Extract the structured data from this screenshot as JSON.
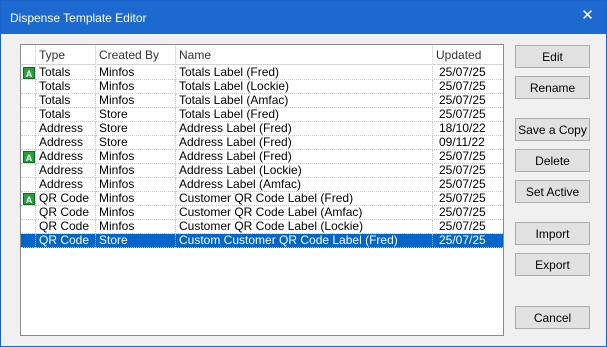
{
  "window": {
    "title": "Dispense Template Editor",
    "close_glyph": "✕",
    "accent_color": "#1c6ad0"
  },
  "list": {
    "columns": [
      "",
      "Type",
      "Created By",
      "Name",
      "Updated"
    ],
    "active_badge": "A",
    "rows": [
      {
        "active": true,
        "type": "Totals",
        "created_by": "Minfos",
        "name": "Totals Label (Fred)",
        "updated": "25/07/25",
        "selected": false
      },
      {
        "active": false,
        "type": "Totals",
        "created_by": "Minfos",
        "name": "Totals Label (Lockie)",
        "updated": "25/07/25",
        "selected": false
      },
      {
        "active": false,
        "type": "Totals",
        "created_by": "Minfos",
        "name": "Totals Label (Amfac)",
        "updated": "25/07/25",
        "selected": false
      },
      {
        "active": false,
        "type": "Totals",
        "created_by": "Store",
        "name": "Totals Label (Fred)",
        "updated": "25/07/25",
        "selected": false
      },
      {
        "active": false,
        "type": "Address",
        "created_by": "Store",
        "name": "Address Label (Fred)",
        "updated": "18/10/22",
        "selected": false
      },
      {
        "active": false,
        "type": "Address",
        "created_by": "Store",
        "name": "Address Label (Fred)",
        "updated": "09/11/22",
        "selected": false
      },
      {
        "active": true,
        "type": "Address",
        "created_by": "Minfos",
        "name": "Address Label (Fred)",
        "updated": "25/07/25",
        "selected": false
      },
      {
        "active": false,
        "type": "Address",
        "created_by": "Minfos",
        "name": "Address Label (Lockie)",
        "updated": "25/07/25",
        "selected": false
      },
      {
        "active": false,
        "type": "Address",
        "created_by": "Minfos",
        "name": "Address Label (Amfac)",
        "updated": "25/07/25",
        "selected": false
      },
      {
        "active": true,
        "type": "QR Code",
        "created_by": "Minfos",
        "name": "Customer QR Code Label (Fred)",
        "updated": "25/07/25",
        "selected": false
      },
      {
        "active": false,
        "type": "QR Code",
        "created_by": "Minfos",
        "name": "Customer QR Code Label (Amfac)",
        "updated": "25/07/25",
        "selected": false
      },
      {
        "active": false,
        "type": "QR Code",
        "created_by": "Minfos",
        "name": "Customer QR Code Label (Lockie)",
        "updated": "25/07/25",
        "selected": false
      },
      {
        "active": false,
        "type": "QR Code",
        "created_by": "Store",
        "name": "Custom Customer QR Code Label (Fred)",
        "updated": "25/07/25",
        "selected": true
      }
    ]
  },
  "buttons": {
    "edit": "Edit",
    "rename": "Rename",
    "save_a_copy": "Save a Copy",
    "delete": "Delete",
    "set_active": "Set Active",
    "import": "Import",
    "export": "Export",
    "cancel": "Cancel"
  }
}
